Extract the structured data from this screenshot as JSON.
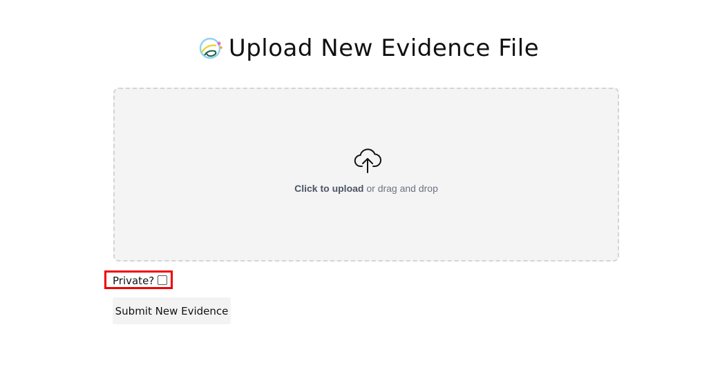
{
  "header": {
    "title": "Upload New Evidence File",
    "logo_icon": "app-logo-icon"
  },
  "dropzone": {
    "icon": "cloud-upload-icon",
    "click_text": "Click to upload",
    "rest_text": " or drag and drop"
  },
  "form": {
    "private_label": "Private?",
    "private_checked": false,
    "submit_label": "Submit New Evidence"
  },
  "colors": {
    "highlight_border": "#ee0000",
    "dropzone_bg": "#f4f4f4",
    "dropzone_border": "#d4d4d4",
    "button_bg": "#f3f3f3"
  }
}
